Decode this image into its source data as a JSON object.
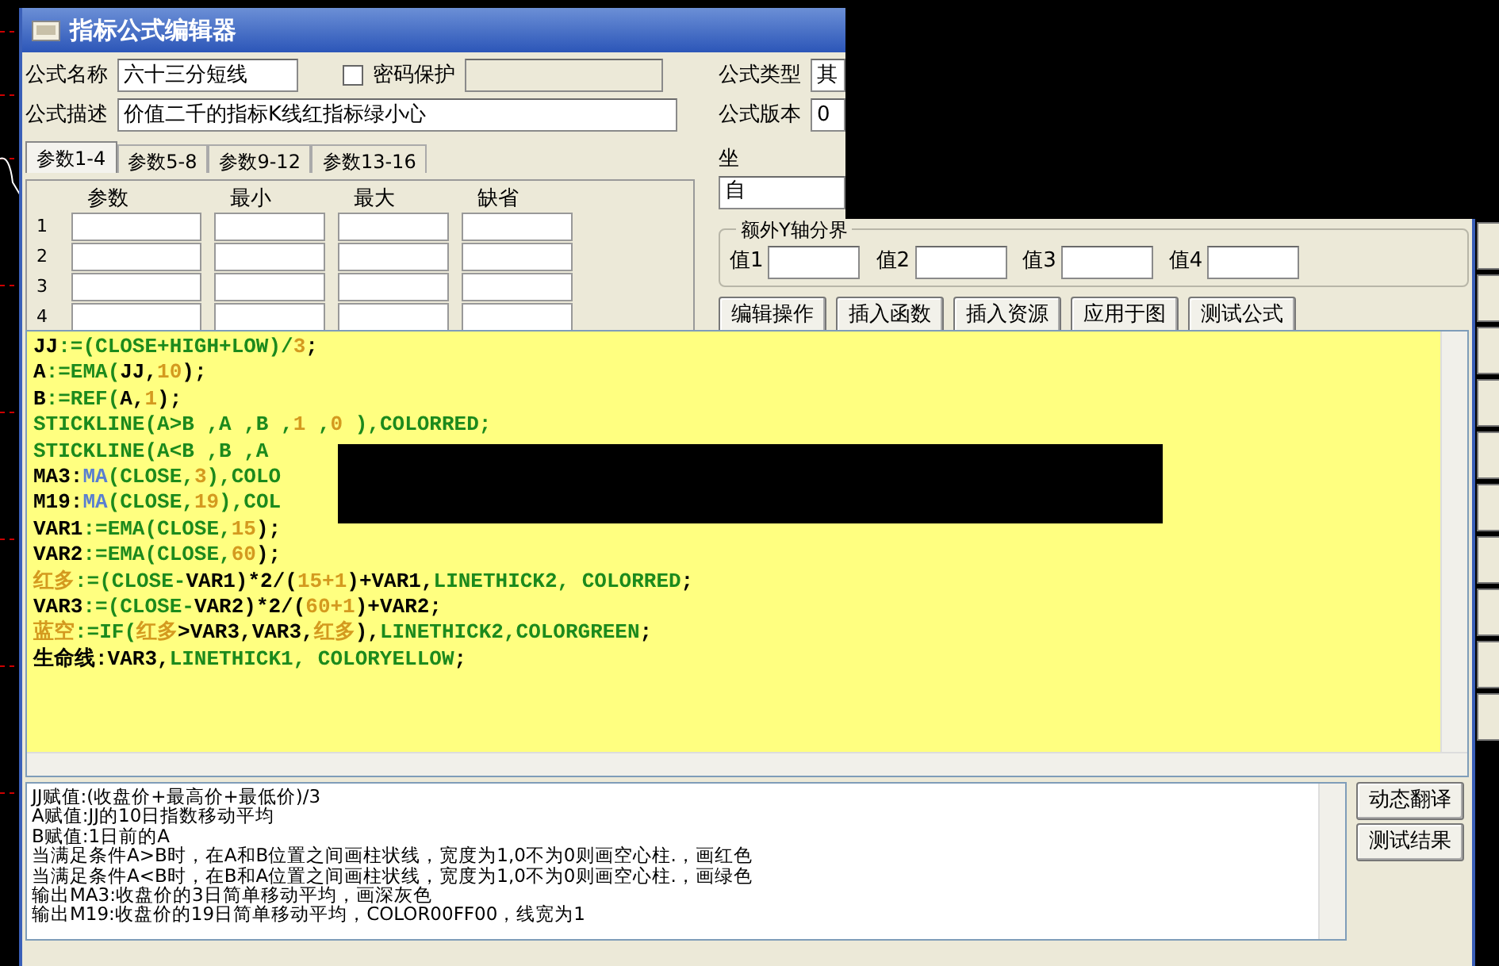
{
  "window": {
    "title": "指标公式编辑器"
  },
  "form": {
    "name_label": "公式名称",
    "name_value": "六十三分短线",
    "password": {
      "label": "密码保护",
      "checked": false
    },
    "description_label": "公式描述",
    "description_value": "价值二千的指标K线红指标绿小心",
    "type_label": "公式类型",
    "type_value": "其",
    "version_label": "公式版本",
    "version_value": "0"
  },
  "param_tabs": [
    {
      "label": "参数1-4",
      "selected": true
    },
    {
      "label": "参数5-8",
      "selected": false
    },
    {
      "label": "参数9-12",
      "selected": false
    },
    {
      "label": "参数13-16",
      "selected": false
    }
  ],
  "param_table": {
    "columns": [
      "参数",
      "最小",
      "最大",
      "缺省"
    ],
    "rows": [
      "1",
      "2",
      "3",
      "4"
    ]
  },
  "axis": {
    "label": "坐",
    "value": "自"
  },
  "y_axis_group": {
    "title": "额外Y轴分界",
    "fields": [
      "值1",
      "值2",
      "值3",
      "值4"
    ]
  },
  "buttons": [
    "编辑操作",
    "插入函数",
    "插入资源",
    "应用于图",
    "测试公式"
  ],
  "code_lines": [
    [
      {
        "text": "JJ",
        "kind": "plain"
      },
      {
        "text": ":=(CLOSE+HIGH+LOW)/",
        "kind": "func"
      },
      {
        "text": "3",
        "kind": "num"
      },
      {
        "text": ";",
        "kind": "plain"
      }
    ],
    [
      {
        "text": "A",
        "kind": "plain"
      },
      {
        "text": ":=EMA(",
        "kind": "func"
      },
      {
        "text": "JJ,",
        "kind": "plain"
      },
      {
        "text": "10",
        "kind": "num"
      },
      {
        "text": ");",
        "kind": "plain"
      }
    ],
    [
      {
        "text": "B",
        "kind": "plain"
      },
      {
        "text": ":=REF(",
        "kind": "func"
      },
      {
        "text": "A,",
        "kind": "plain"
      },
      {
        "text": "1",
        "kind": "num"
      },
      {
        "text": ");",
        "kind": "plain"
      }
    ],
    [
      {
        "text": "STICKLINE(A>B ,A ,B ,",
        "kind": "func"
      },
      {
        "text": "1",
        "kind": "num"
      },
      {
        "text": " ,",
        "kind": "func"
      },
      {
        "text": "0",
        "kind": "num"
      },
      {
        "text": " ),COLORRED;",
        "kind": "func"
      }
    ],
    [
      {
        "text": "STICKLINE(A<B ,B ,A",
        "kind": "func"
      }
    ],
    [
      {
        "text": "MA3:",
        "kind": "plain"
      },
      {
        "text": "MA",
        "kind": "blue"
      },
      {
        "text": "(CLOSE,",
        "kind": "func"
      },
      {
        "text": "3",
        "kind": "num"
      },
      {
        "text": "),COLO",
        "kind": "func"
      }
    ],
    [
      {
        "text": "M19:",
        "kind": "plain"
      },
      {
        "text": "MA",
        "kind": "blue"
      },
      {
        "text": "(CLOSE,",
        "kind": "func"
      },
      {
        "text": "19",
        "kind": "num"
      },
      {
        "text": "),COL",
        "kind": "func"
      }
    ],
    [
      {
        "text": "VAR1",
        "kind": "plain"
      },
      {
        "text": ":=EMA(CLOSE,",
        "kind": "func"
      },
      {
        "text": "15",
        "kind": "num"
      },
      {
        "text": ");",
        "kind": "plain"
      }
    ],
    [
      {
        "text": "VAR2",
        "kind": "plain"
      },
      {
        "text": ":=EMA(CLOSE,",
        "kind": "func"
      },
      {
        "text": "60",
        "kind": "num"
      },
      {
        "text": ");",
        "kind": "plain"
      }
    ],
    [
      {
        "text": "红多",
        "kind": "num"
      },
      {
        "text": ":=(CLOSE-",
        "kind": "func"
      },
      {
        "text": "VAR1)*2/(",
        "kind": "plain"
      },
      {
        "text": "15+1",
        "kind": "num"
      },
      {
        "text": ")+VAR1,",
        "kind": "plain"
      },
      {
        "text": "LINETHICK2, COLORRED",
        "kind": "func"
      },
      {
        "text": ";",
        "kind": "plain"
      }
    ],
    [
      {
        "text": "VAR3",
        "kind": "plain"
      },
      {
        "text": ":=(CLOSE-",
        "kind": "func"
      },
      {
        "text": "VAR2)*2/(",
        "kind": "plain"
      },
      {
        "text": "60+1",
        "kind": "num"
      },
      {
        "text": ")+VAR2;",
        "kind": "plain"
      }
    ],
    [
      {
        "text": "蓝空",
        "kind": "num"
      },
      {
        "text": ":=IF(",
        "kind": "func"
      },
      {
        "text": "红多",
        "kind": "num"
      },
      {
        "text": ">VAR3,VAR3,",
        "kind": "plain"
      },
      {
        "text": "红多",
        "kind": "num"
      },
      {
        "text": "),",
        "kind": "plain"
      },
      {
        "text": "LINETHICK2,COLORGREEN",
        "kind": "func"
      },
      {
        "text": ";",
        "kind": "plain"
      }
    ],
    [
      {
        "text": "生命线",
        "kind": "plain"
      },
      {
        "text": ":VAR3,",
        "kind": "plain"
      },
      {
        "text": "LINETHICK1, COLORYELLOW",
        "kind": "func"
      },
      {
        "text": ";",
        "kind": "plain"
      }
    ]
  ],
  "explanation_lines": [
    "JJ赋值:(收盘价+最高价+最低价)/3",
    "A赋值:JJ的10日指数移动平均",
    "B赋值:1日前的A",
    "当满足条件A>B时，在A和B位置之间画柱状线，宽度为1,0不为0则画空心柱.，画红色",
    "当满足条件A<B时，在B和A位置之间画柱状线，宽度为1,0不为0则画空心柱.，画绿色",
    "输出MA3:收盘价的3日简单移动平均，画深灰色",
    "输出M19:收盘价的19日简单移动平均，COLOR00FF00，线宽为1"
  ],
  "side_buttons": [
    "动态翻译",
    "测试结果"
  ]
}
